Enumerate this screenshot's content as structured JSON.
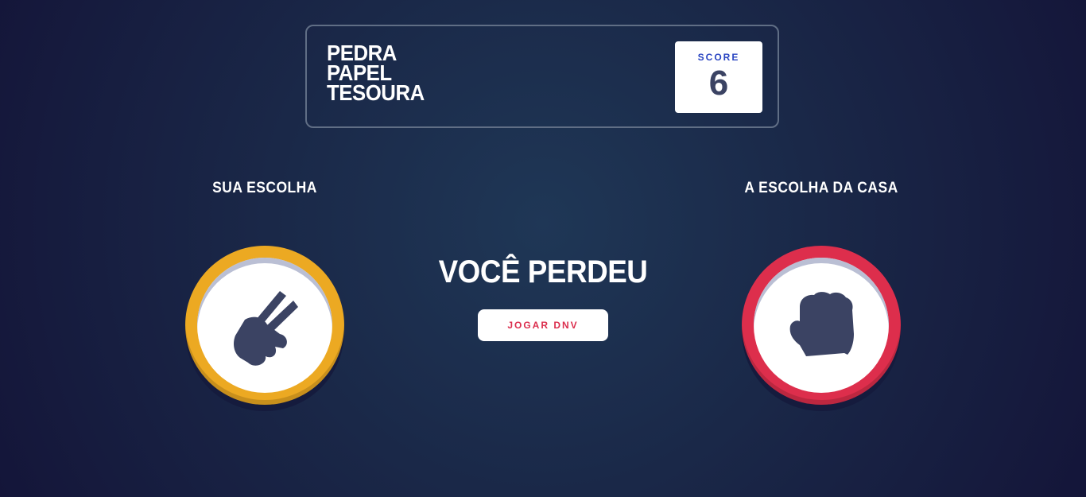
{
  "header": {
    "title_lines": [
      "PEDRA",
      "PAPEL",
      "TESOURA"
    ],
    "score_label": "SCORE",
    "score_value": "6"
  },
  "picks": {
    "player_label": "SUA ESCOLHA",
    "house_label": "A ESCOLHA DA CASA",
    "player_choice": {
      "icon": "scissors-icon",
      "ring_color": "#eca922"
    },
    "house_choice": {
      "icon": "rock-icon",
      "ring_color": "#dd2e4c"
    }
  },
  "result": {
    "text": "VOCÊ PERDEU",
    "play_again_label": "JOGAR DNV"
  },
  "colors": {
    "icon_fill": "#3b4363",
    "score_label": "#2a45c2",
    "button_text": "#db2e4d"
  }
}
